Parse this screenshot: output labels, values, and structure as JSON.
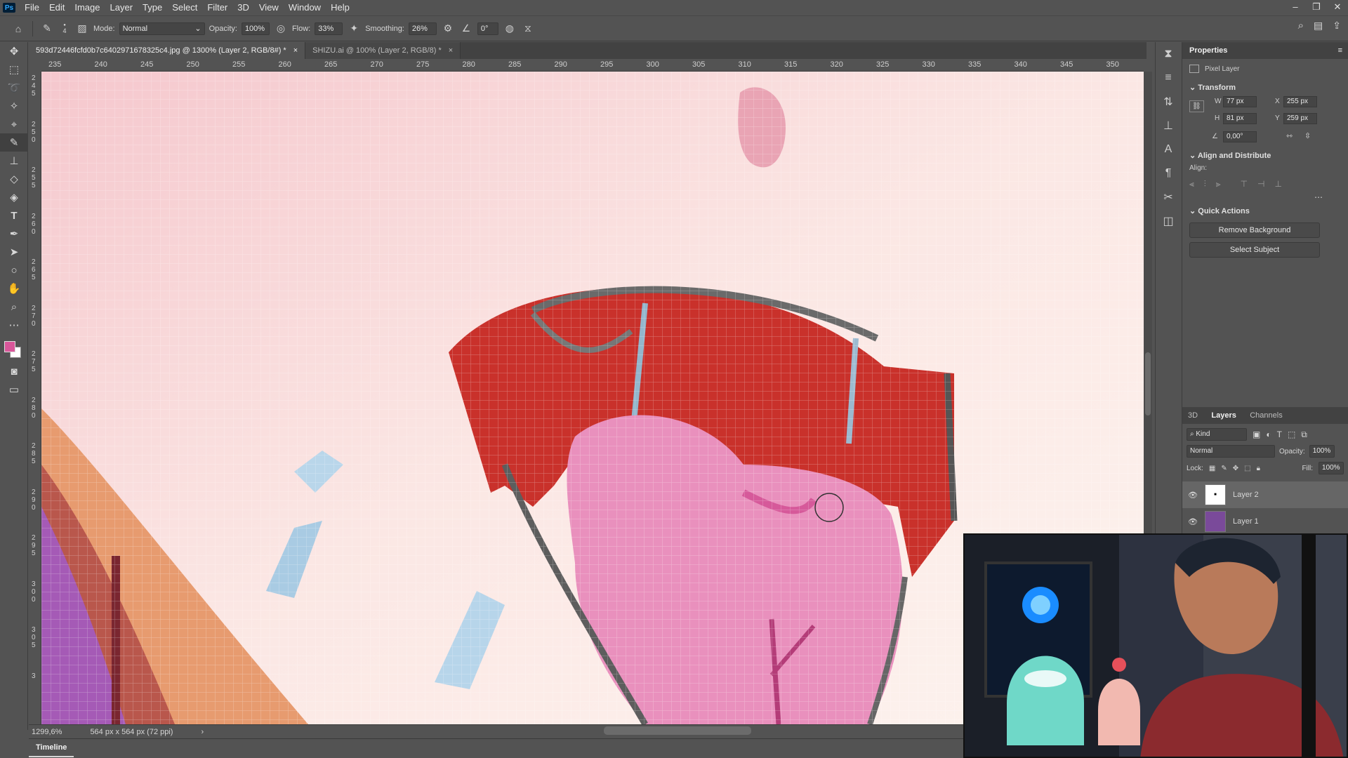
{
  "menubar": {
    "app_icon": "Ps",
    "items": [
      "File",
      "Edit",
      "Image",
      "Layer",
      "Type",
      "Select",
      "Filter",
      "3D",
      "View",
      "Window",
      "Help"
    ]
  },
  "options_bar": {
    "brush_size": "4",
    "mode_label": "Mode:",
    "mode_value": "Normal",
    "opacity_label": "Opacity:",
    "opacity_value": "100%",
    "flow_label": "Flow:",
    "flow_value": "33%",
    "smoothing_label": "Smoothing:",
    "smoothing_value": "26%",
    "angle_value": "0°"
  },
  "tabs": [
    {
      "label": "593d72446fcfd0b7c6402971678325c4.jpg @ 1300% (Layer 2, RGB/8#) *",
      "close": "×"
    },
    {
      "label": "SHIZU.ai @ 100% (Layer 2, RGB/8) *",
      "close": "×"
    }
  ],
  "ruler_h": [
    "235",
    "240",
    "245",
    "250",
    "255",
    "260",
    "265",
    "270",
    "275",
    "280",
    "285",
    "290",
    "295",
    "300",
    "305",
    "310",
    "315",
    "320",
    "325",
    "330",
    "335",
    "340",
    "345",
    "350"
  ],
  "ruler_v": [
    "245",
    "250",
    "255",
    "260",
    "265",
    "270",
    "275",
    "280",
    "285",
    "290",
    "295",
    "300",
    "305",
    "3"
  ],
  "status": {
    "zoom": "1299,6%",
    "doc_info": "564 px x 564 px (72 ppi)"
  },
  "timeline": {
    "label": "Timeline"
  },
  "properties": {
    "title": "Properties",
    "layer_type": "Pixel Layer",
    "transform": {
      "title": "Transform",
      "w_label": "W",
      "w_value": "77 px",
      "h_label": "H",
      "h_value": "81 px",
      "x_label": "X",
      "x_value": "255 px",
      "y_label": "Y",
      "y_value": "259 px",
      "angle_value": "0,00°"
    },
    "align": {
      "title": "Align and Distribute",
      "align_label": "Align:"
    },
    "quick_actions": {
      "title": "Quick Actions",
      "remove_bg": "Remove Background",
      "select_subject": "Select Subject"
    }
  },
  "layers_panel": {
    "tabs": [
      "3D",
      "Layers",
      "Channels"
    ],
    "filter_kind": "Kind",
    "blend_mode": "Normal",
    "opacity_label": "Opacity:",
    "opacity_value": "100%",
    "lock_label": "Lock:",
    "fill_label": "Fill:",
    "fill_value": "100%",
    "layers": [
      {
        "name": "Layer 2",
        "selected": true
      },
      {
        "name": "Layer 1",
        "selected": false
      }
    ]
  },
  "colors": {
    "foreground": "#d9579a",
    "background": "#ffffff",
    "ui_bg": "#535353",
    "panel_dark": "#424242"
  }
}
